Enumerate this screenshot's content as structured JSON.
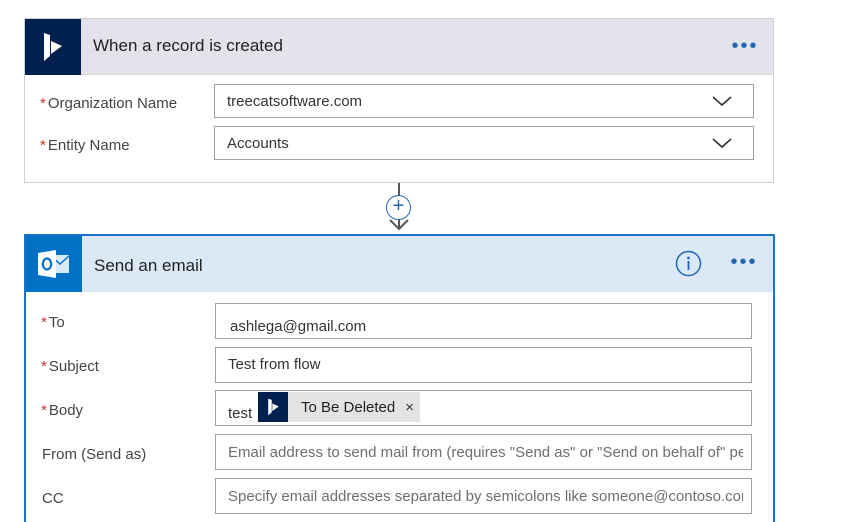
{
  "trigger": {
    "title": "When a record is created",
    "more_label": "•••",
    "fields": [
      {
        "label": "Organization Name",
        "required_mark": "*",
        "value": "treecatsoftware.com"
      },
      {
        "label": "Entity Name",
        "required_mark": "*",
        "value": "Accounts"
      }
    ]
  },
  "connector": {
    "add_label": "+"
  },
  "action": {
    "title": "Send an email",
    "more_label": "•••",
    "fields": {
      "to": {
        "label": "To",
        "required_mark": "*",
        "value": "ashlega@gmail.com"
      },
      "subject": {
        "label": "Subject",
        "required_mark": "*",
        "value": "Test from flow"
      },
      "body": {
        "label": "Body",
        "required_mark": "*",
        "prefix": "test",
        "token_label": "To Be Deleted",
        "token_close": "×"
      },
      "from": {
        "label": "From (Send as)",
        "placeholder": "Email address to send mail from (requires \"Send as\" or \"Send on behalf of\" pe"
      },
      "cc": {
        "label": "CC",
        "placeholder": "Specify email addresses separated by semicolons like someone@contoso.com"
      }
    }
  },
  "colors": {
    "dynamics_brand": "#002050",
    "outlook_brand": "#0072c6",
    "accent_blue": "#1a73c7",
    "required_red": "#c0392b"
  }
}
